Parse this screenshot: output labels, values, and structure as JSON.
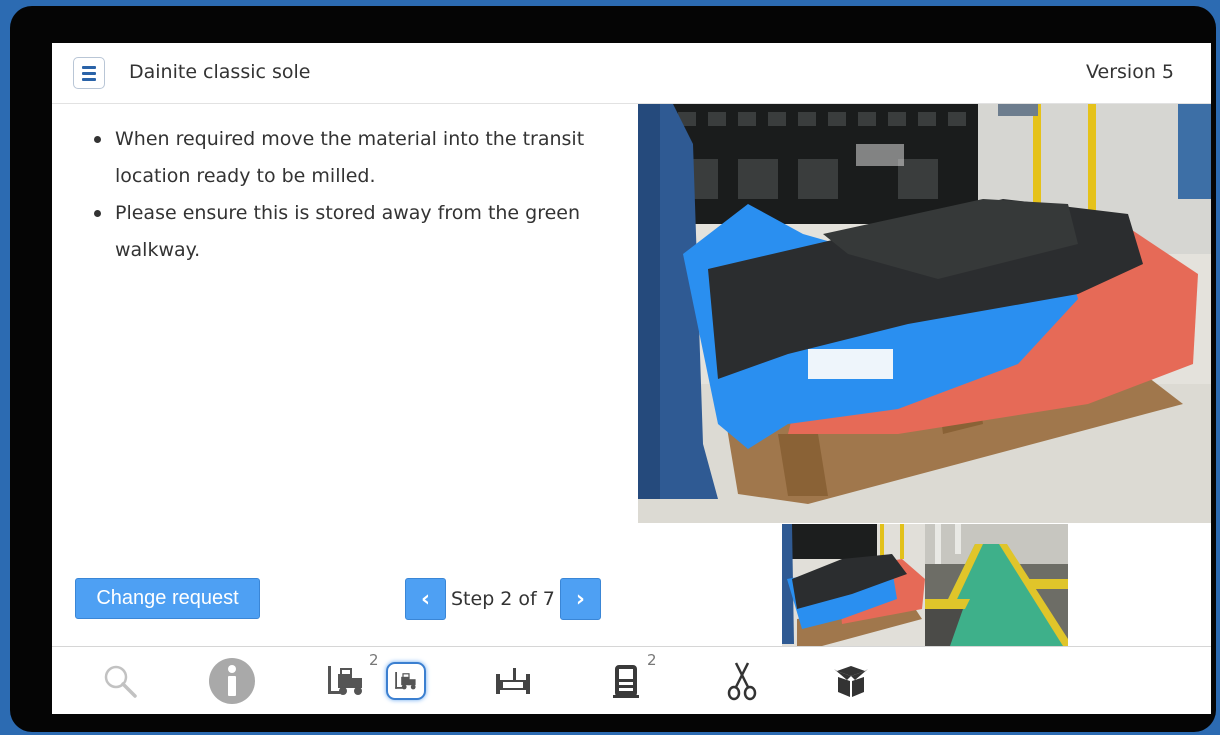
{
  "header": {
    "menu_icon": "hamburger-menu-icon",
    "title": "Dainite classic sole",
    "version": "Version 5"
  },
  "instructions": [
    "When required move the material into the transit location ready to be milled.",
    "Please ensure this is stored away from the green walkway."
  ],
  "gallery": {
    "main_image": "photo of rubber sheets on a pallet in a warehouse",
    "thumbnails": [
      "rubber-sheets-pallet-thumbnail",
      "green-walkway-thumbnail"
    ]
  },
  "actions": {
    "change_request": "Change request"
  },
  "step_nav": {
    "label": "Step 2 of 7",
    "prev_icon": "chevron-left-icon",
    "next_icon": "chevron-right-icon"
  },
  "toolbar": {
    "items": [
      {
        "icon": "search-icon"
      },
      {
        "icon": "info-icon"
      },
      {
        "icon": "forklift-icon",
        "badge": "2"
      },
      {
        "icon": "forklift-icon",
        "active": true
      },
      {
        "icon": "milling-machine-icon"
      },
      {
        "icon": "dispenser-machine-icon",
        "badge": "2"
      },
      {
        "icon": "scissors-icon"
      },
      {
        "icon": "box-icon"
      }
    ]
  },
  "colors": {
    "button_blue": "#4ea0f3",
    "menu_icon_blue": "#2a63a8",
    "outer_background": "#2c6bb2"
  }
}
